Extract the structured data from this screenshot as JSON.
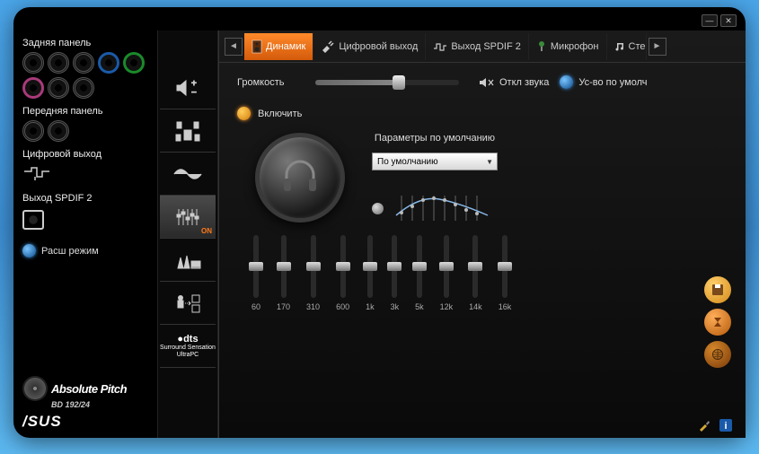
{
  "titlebar": {
    "minimize": "—",
    "close": "✕"
  },
  "panels": {
    "rear_label": "Задняя панель",
    "front_label": "Передняя панель",
    "digital_out": "Цифровой выход",
    "spdif_out": "Выход SPDIF 2",
    "adv_mode": "Расш режим"
  },
  "brand": {
    "pitch": "Absolute Pitch",
    "sub": "BD 192/24",
    "logo": "/SUS"
  },
  "iconbar": {
    "on_label": "ON"
  },
  "dts": {
    "title": "dts",
    "line1": "Surround Sensation",
    "line2": "UltraPC"
  },
  "tabs": {
    "items": [
      {
        "label": "Динамик"
      },
      {
        "label": "Цифровой выход"
      },
      {
        "label": "Выход SPDIF 2"
      },
      {
        "label": "Микрофон"
      },
      {
        "label": "Стер"
      }
    ]
  },
  "volume": {
    "label": "Громкость",
    "mute": "Откл звука",
    "default_device": "Ус-во по умолч"
  },
  "enable": {
    "label": "Включить"
  },
  "defaults": {
    "label": "Параметры по умолчанию",
    "selected": "По умолчанию"
  },
  "eq": {
    "bands": [
      "60",
      "170",
      "310",
      "600",
      "1k",
      "3k",
      "5k",
      "12k",
      "14k",
      "16k"
    ]
  }
}
